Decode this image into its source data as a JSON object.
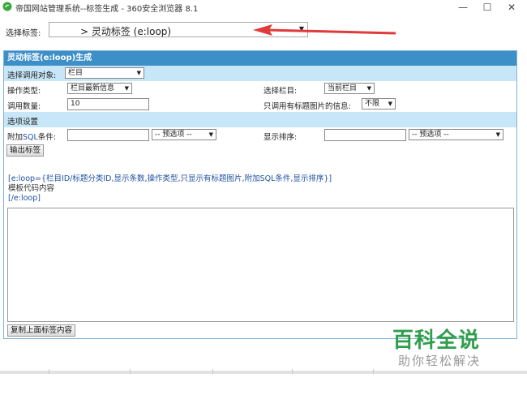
{
  "window": {
    "title": "帝国网站管理系统--标签生成 - 360安全浏览器 8.1",
    "controls": {
      "minimize": "—",
      "maximize": "☐",
      "close": "✕"
    }
  },
  "tag_select": {
    "label": "选择标签:",
    "value": "> 灵动标签 (e:loop)"
  },
  "panel": {
    "header": "灵动标签(e:loop)生成",
    "call_object": {
      "label": "选择调用对象:",
      "value": "栏目"
    },
    "op_type": {
      "label": "操作类型:",
      "value": "栏目最新信息"
    },
    "select_column": {
      "label": "选择栏目:",
      "value": "当前栏目"
    },
    "count": {
      "label": "调用数量:",
      "value": "10"
    },
    "only_title_pic": {
      "label": "只调用有标题图片的信息:",
      "value": "不限"
    },
    "options_header": "选项设置",
    "sql_condition": {
      "label_pre": "附加",
      "label_sql": "SQL",
      "label_post": "条件:",
      "value": "",
      "preset": "-- 预选项 --"
    },
    "sort": {
      "label": "显示排序:",
      "value": "",
      "preset": "-- 预选项 --"
    },
    "output_button": "输出标签",
    "code_lines": [
      "[e:loop={栏目ID/标题分类ID,显示条数,操作类型,只显示有标题图片,附加SQL条件,显示排序}]",
      "模板代码内容",
      "[/e:loop]"
    ],
    "textarea_value": "",
    "copy_button": "复制上面标签内容"
  },
  "watermark": {
    "big": "百科全说",
    "small": "助你轻松解决"
  },
  "colors": {
    "header_blue": "#3d8fc8",
    "row_light": "#c7e6f7",
    "code_blue": "#2050a0",
    "watermark_green": "#2f9e4b",
    "arrow_red": "#e03a3a"
  }
}
